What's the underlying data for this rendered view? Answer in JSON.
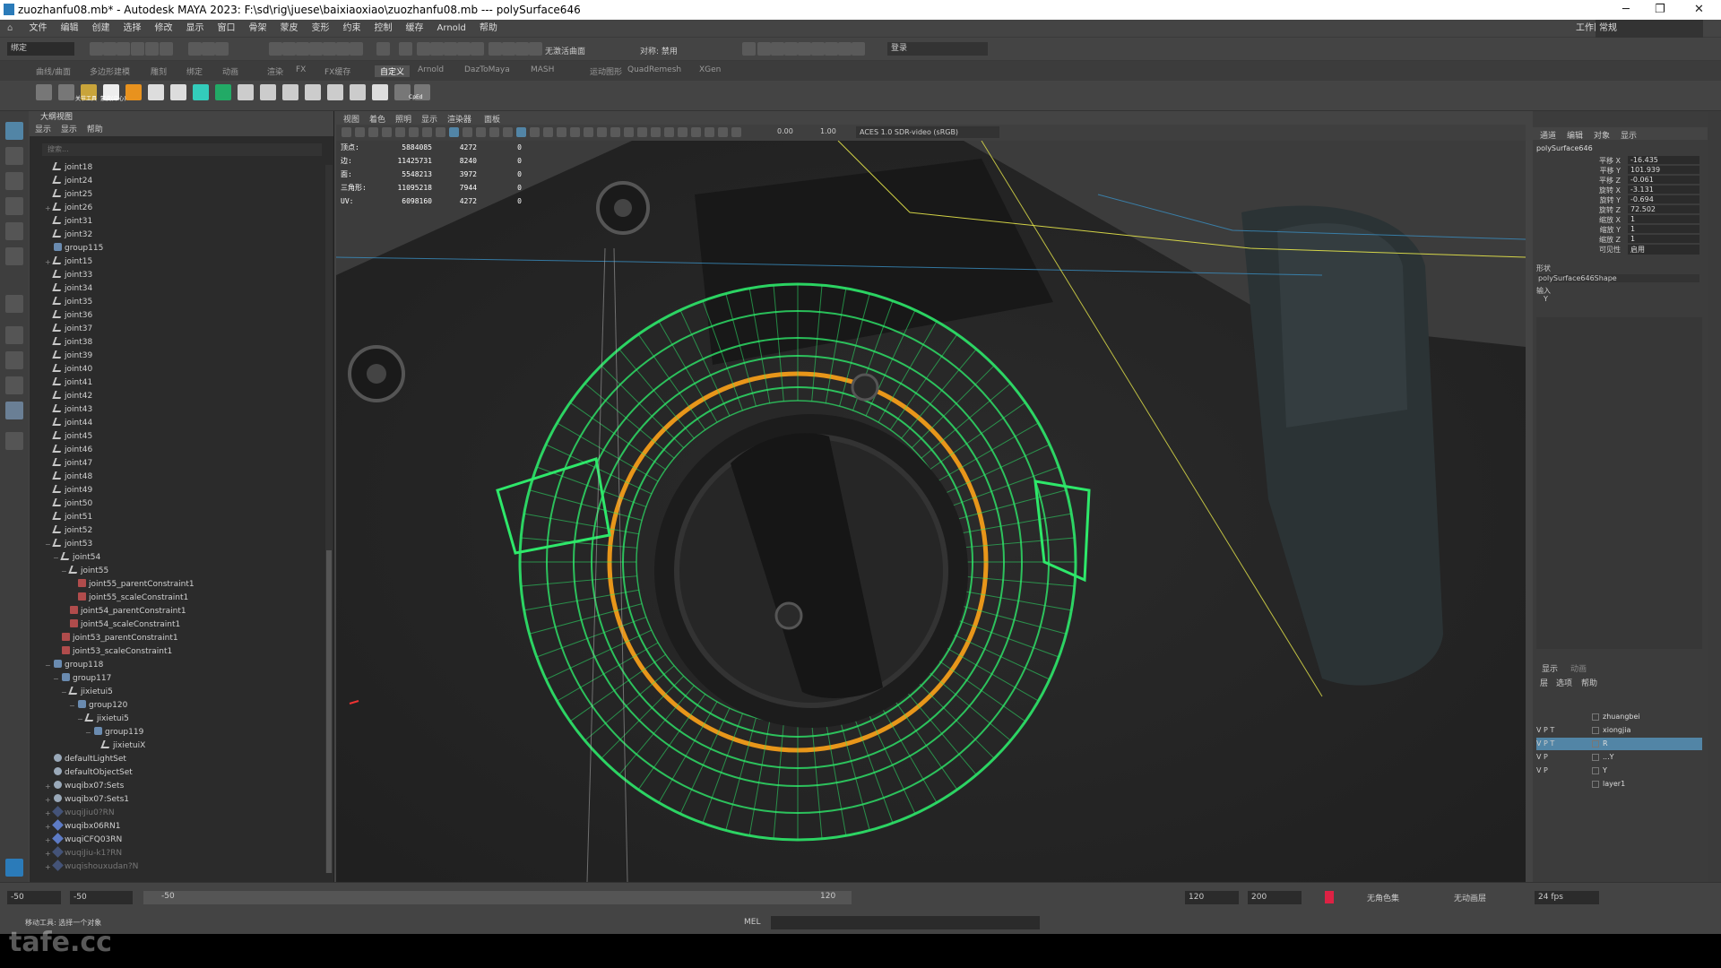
{
  "window": {
    "title": "zuozhanfu08.mb* - Autodesk MAYA 2023: F:\\sd\\rig\\juese\\baixiaoxiao\\zuozhanfu08.mb  ---  polySurface646",
    "minimize": "─",
    "maximize": "❐",
    "close": "✕"
  },
  "menus": [
    "文件",
    "编辑",
    "创建",
    "选择",
    "修改",
    "显示",
    "窗口",
    "骨架",
    "蒙皮",
    "变形",
    "约束",
    "控制",
    "缓存",
    "Arnold",
    "帮助"
  ],
  "workspace": {
    "label": "工作区:",
    "value": "常规"
  },
  "status": {
    "mode": "绑定",
    "symmetry": "无激活曲面",
    "symmetry_label": "对称: 禁用",
    "login": "登录"
  },
  "shelf_tabs": [
    "曲线/曲面",
    "多边形建模",
    "雕刻",
    "绑定",
    "动画",
    "渲染",
    "FX",
    "FX缓存",
    "自定义",
    "Arnold",
    "DazToMaya",
    "MASH",
    "运动图形",
    "QuadRemesh",
    "XGen"
  ],
  "shelf_labels": {
    "s1": "关节工具",
    "s2": "蒙皮(中心)",
    "s3": "CpEd"
  },
  "outliner": {
    "title": "大纲视图",
    "menu": [
      "显示",
      "显示",
      "帮助"
    ],
    "search_placeholder": "搜索...",
    "items": [
      {
        "label": "joint18",
        "type": "joint",
        "depth": 1
      },
      {
        "label": "joint24",
        "type": "joint",
        "depth": 1
      },
      {
        "label": "joint25",
        "type": "joint",
        "depth": 1
      },
      {
        "label": "joint26",
        "type": "joint",
        "depth": 1,
        "exp": "+"
      },
      {
        "label": "joint31",
        "type": "joint",
        "depth": 1
      },
      {
        "label": "joint32",
        "type": "joint",
        "depth": 1
      },
      {
        "label": "group115",
        "type": "group",
        "depth": 1
      },
      {
        "label": "joint15",
        "type": "joint",
        "depth": 1,
        "exp": "+"
      },
      {
        "label": "joint33",
        "type": "joint",
        "depth": 1
      },
      {
        "label": "joint34",
        "type": "joint",
        "depth": 1
      },
      {
        "label": "joint35",
        "type": "joint",
        "depth": 1
      },
      {
        "label": "joint36",
        "type": "joint",
        "depth": 1
      },
      {
        "label": "joint37",
        "type": "joint",
        "depth": 1
      },
      {
        "label": "joint38",
        "type": "joint",
        "depth": 1
      },
      {
        "label": "joint39",
        "type": "joint",
        "depth": 1
      },
      {
        "label": "joint40",
        "type": "joint",
        "depth": 1
      },
      {
        "label": "joint41",
        "type": "joint",
        "depth": 1
      },
      {
        "label": "joint42",
        "type": "joint",
        "depth": 1
      },
      {
        "label": "joint43",
        "type": "joint",
        "depth": 1
      },
      {
        "label": "joint44",
        "type": "joint",
        "depth": 1
      },
      {
        "label": "joint45",
        "type": "joint",
        "depth": 1
      },
      {
        "label": "joint46",
        "type": "joint",
        "depth": 1
      },
      {
        "label": "joint47",
        "type": "joint",
        "depth": 1
      },
      {
        "label": "joint48",
        "type": "joint",
        "depth": 1
      },
      {
        "label": "joint49",
        "type": "joint",
        "depth": 1
      },
      {
        "label": "joint50",
        "type": "joint",
        "depth": 1
      },
      {
        "label": "joint51",
        "type": "joint",
        "depth": 1
      },
      {
        "label": "joint52",
        "type": "joint",
        "depth": 1
      },
      {
        "label": "joint53",
        "type": "joint",
        "depth": 1,
        "exp": "−"
      },
      {
        "label": "joint54",
        "type": "joint",
        "depth": 2,
        "exp": "−"
      },
      {
        "label": "joint55",
        "type": "joint",
        "depth": 3,
        "exp": "−"
      },
      {
        "label": "joint55_parentConstraint1",
        "type": "constraint",
        "depth": 4
      },
      {
        "label": "joint55_scaleConstraint1",
        "type": "constraint",
        "depth": 4
      },
      {
        "label": "joint54_parentConstraint1",
        "type": "constraint",
        "depth": 3
      },
      {
        "label": "joint54_scaleConstraint1",
        "type": "constraint",
        "depth": 3
      },
      {
        "label": "joint53_parentConstraint1",
        "type": "constraint",
        "depth": 2
      },
      {
        "label": "joint53_scaleConstraint1",
        "type": "constraint",
        "depth": 2
      },
      {
        "label": "group118",
        "type": "group",
        "depth": 1,
        "exp": "−"
      },
      {
        "label": "group117",
        "type": "group",
        "depth": 2,
        "exp": "−"
      },
      {
        "label": "jixietui5",
        "type": "joint",
        "depth": 3,
        "exp": "−"
      },
      {
        "label": "group120",
        "type": "group",
        "depth": 4,
        "exp": "−"
      },
      {
        "label": "jixietui5",
        "type": "joint",
        "depth": 5,
        "exp": "−"
      },
      {
        "label": "group119",
        "type": "group",
        "depth": 6,
        "exp": "−"
      },
      {
        "label": "jixietuiX",
        "type": "joint",
        "depth": 7
      },
      {
        "label": "defaultLightSet",
        "type": "set",
        "depth": 1
      },
      {
        "label": "defaultObjectSet",
        "type": "set",
        "depth": 1
      },
      {
        "label": "wuqibx07:Sets",
        "type": "set",
        "depth": 1,
        "exp": "+"
      },
      {
        "label": "wuqibx07:Sets1",
        "type": "set",
        "depth": 1,
        "exp": "+"
      },
      {
        "label": "wuqiJiu0?RN",
        "type": "ref",
        "depth": 1,
        "exp": "+",
        "dim": true
      },
      {
        "label": "wuqibx06RN1",
        "type": "ref",
        "depth": 1,
        "exp": "+"
      },
      {
        "label": "wuqiCFQ03RN",
        "type": "ref",
        "depth": 1,
        "exp": "+"
      },
      {
        "label": "wuqiJiu-k1?RN",
        "type": "ref",
        "depth": 1,
        "exp": "+",
        "dim": true
      },
      {
        "label": "wuqishouxudan?N",
        "type": "ref",
        "depth": 1,
        "exp": "+",
        "dim": true
      }
    ]
  },
  "viewport": {
    "menu": [
      "视图",
      "着色",
      "照明",
      "显示",
      "渲染器",
      "面板"
    ],
    "exposure": "0.00",
    "gamma": "1.00",
    "colorspace": "ACES 1.0 SDR-video (sRGB)",
    "hud": [
      {
        "label": "顶点:",
        "a": "5884085",
        "b": "4272",
        "c": "0"
      },
      {
        "label": "边:",
        "a": "11425731",
        "b": "8240",
        "c": "0"
      },
      {
        "label": "面:",
        "a": "5548213",
        "b": "3972",
        "c": "0"
      },
      {
        "label": "三角形:",
        "a": "11095218",
        "b": "7944",
        "c": "0"
      },
      {
        "label": "UV:",
        "a": "6098160",
        "b": "4272",
        "c": "0"
      }
    ]
  },
  "channelbox": {
    "menu": [
      "通道",
      "编辑",
      "对象",
      "显示"
    ],
    "object": "polySurface646",
    "attrs": [
      {
        "name": "平移 X",
        "value": "-16.435"
      },
      {
        "name": "平移 Y",
        "value": "101.939"
      },
      {
        "name": "平移 Z",
        "value": "-0.061"
      },
      {
        "name": "旋转 X",
        "value": "-3.131"
      },
      {
        "name": "旋转 Y",
        "value": "-0.694"
      },
      {
        "name": "旋转 Z",
        "value": "72.502"
      },
      {
        "name": "缩放 X",
        "value": "1"
      },
      {
        "name": "缩放 Y",
        "value": "1"
      },
      {
        "name": "缩放 Z",
        "value": "1"
      },
      {
        "name": "可见性",
        "value": "启用"
      }
    ],
    "shapes_label": "形状",
    "shape_name": "polySurface646Shape",
    "inputs_label": "输入",
    "inputs_value": "Y"
  },
  "layers": {
    "tabs": [
      "显示",
      "动画"
    ],
    "menu": [
      "层",
      "选项",
      "帮助"
    ],
    "rows": [
      {
        "vp": "",
        "name": "zhuangbei",
        "color": ""
      },
      {
        "vp": "V  P  T",
        "name": "xiongjia",
        "color": ""
      },
      {
        "vp": "V  P  T",
        "name": "R",
        "color": "#5285a6",
        "sel": true
      },
      {
        "vp": "V  P",
        "name": "...Y",
        "color": ""
      },
      {
        "vp": "V  P",
        "name": "Y",
        "color": ""
      },
      {
        "vp": "",
        "name": "layer1",
        "color": ""
      }
    ]
  },
  "timeline": {
    "start": "-50",
    "range_start": "-50",
    "range_inner": "-50",
    "range_end": "120",
    "end": "120",
    "max": "200",
    "no_char": "无角色集",
    "no_anim": "无动画层",
    "fps": "24 fps"
  },
  "cmdline": {
    "status": "移动工具: 选择一个对象",
    "lang": "MEL"
  },
  "watermark": "tafe.cc",
  "colors": {
    "wire": "#2ee86a",
    "highlight": "#e8961a",
    "bg": "#444444",
    "select": "#5285a6"
  }
}
